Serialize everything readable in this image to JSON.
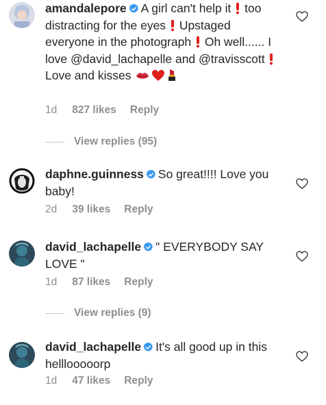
{
  "comments": [
    {
      "username": "amandalepore",
      "text_parts": [
        "A girl can't help it",
        "too distracting for the eyes",
        "Upstaged everyone in the photograph",
        "Oh well...... I love @david_lachapelle  and @travisscott",
        "Love and kisses"
      ],
      "time": "1d",
      "likes": "827 likes",
      "reply": "Reply",
      "view_replies": "View replies (95)"
    },
    {
      "username": "daphne.guinness",
      "text": "So great!!!! Love you baby!",
      "time": "2d",
      "likes": "39 likes",
      "reply": "Reply"
    },
    {
      "username": "david_lachapelle",
      "text": "\" EVERYBODY SAY LOVE \"",
      "time": "1d",
      "likes": "87 likes",
      "reply": "Reply",
      "view_replies": "View replies (9)"
    },
    {
      "username": "david_lachapelle",
      "text": "It's all good up in this helllooooorp",
      "time": "1d",
      "likes": "47 likes",
      "reply": "Reply"
    }
  ],
  "icons": {
    "verified": "verified-badge-icon",
    "like": "heart-outline-icon",
    "exclamation": "red-exclamation-emoji",
    "kiss": "kiss-mark-emoji",
    "heart_red": "red-heart-emoji",
    "lipstick": "lipstick-emoji"
  },
  "colors": {
    "verified_blue": "#3897f0",
    "meta_gray": "#8e8e8e",
    "text": "#262626"
  }
}
